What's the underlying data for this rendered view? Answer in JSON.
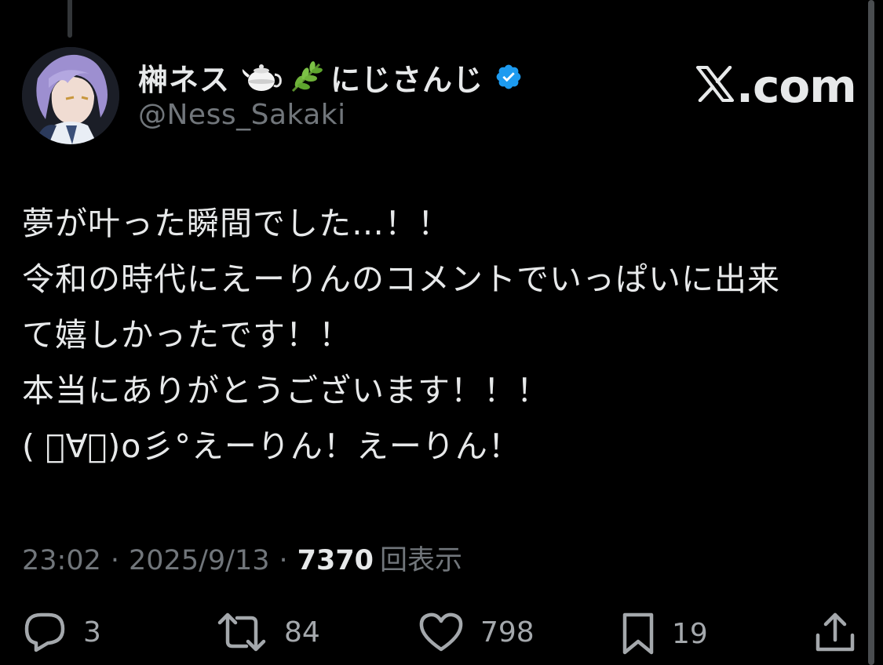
{
  "user": {
    "display_name": "榊ネス",
    "affiliation": "にじさんじ",
    "handle": "@Ness_Sakaki",
    "name_icons": [
      "teapot-icon",
      "herb-icon"
    ],
    "verified": true
  },
  "brand": {
    "label": ".com",
    "icon": "x-logo-icon"
  },
  "tweet": {
    "lines": [
      "夢が叶った瞬間でした…！！",
      "令和の時代にえーりんのコメントでいっぱいに出来",
      "て嬉しかったです！！",
      "本当にありがとうございます！！！",
      "( ﾟ∀ﾟ)o彡°えーりん！えーりん！"
    ]
  },
  "meta": {
    "time": "23:02",
    "date": "2025/9/13",
    "separator": "·",
    "views_count": "7370",
    "views_label": "回表示"
  },
  "actions": {
    "reply": {
      "icon": "reply-icon",
      "count": "3"
    },
    "retweet": {
      "icon": "retweet-icon",
      "count": "84"
    },
    "like": {
      "icon": "heart-icon",
      "count": "798"
    },
    "bookmark": {
      "icon": "bookmark-icon",
      "count": "19"
    },
    "share": {
      "icon": "share-icon"
    }
  },
  "colors": {
    "background": "#000000",
    "text_primary": "#e7e9ea",
    "text_secondary": "#71767b",
    "verified_blue": "#1d9bf0",
    "action_icon": "#a4a8ac"
  }
}
